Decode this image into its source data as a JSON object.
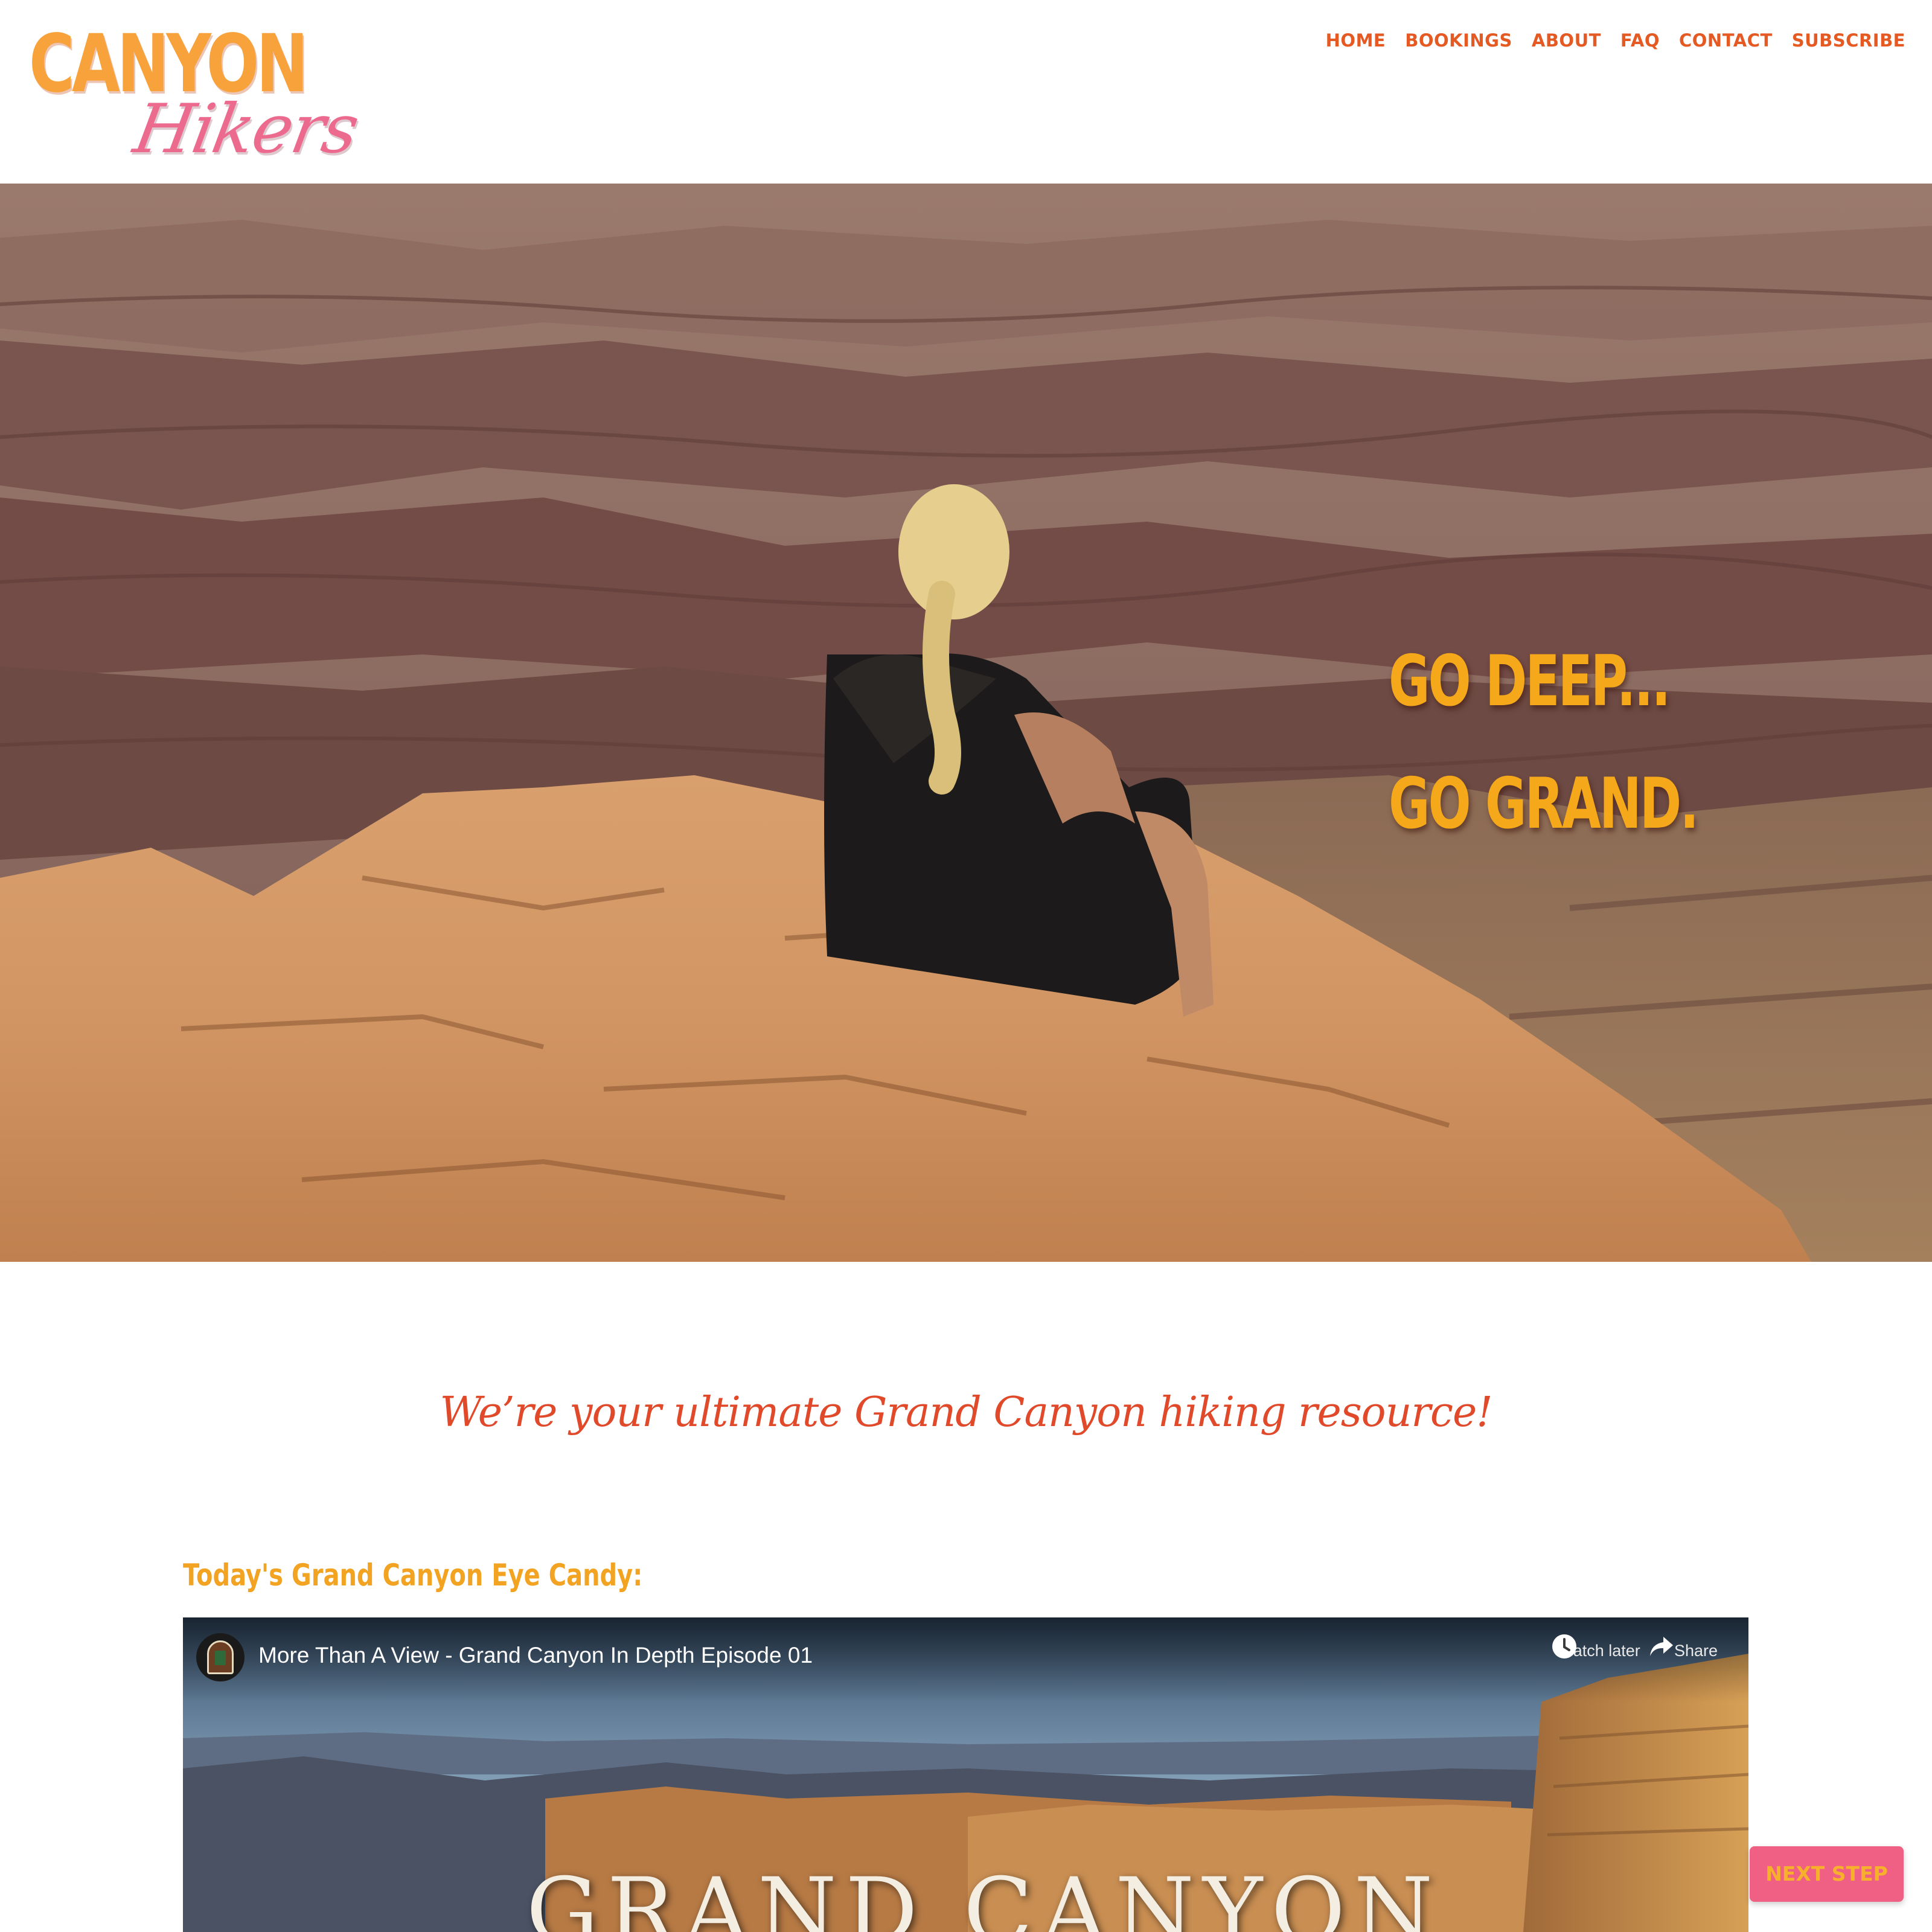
{
  "brand": {
    "logo_line1": "CANYON",
    "logo_line2": "Hikers"
  },
  "nav": {
    "items": [
      "HOME",
      "BOOKINGS",
      "ABOUT",
      "FAQ",
      "CONTACT",
      "SUBSCRIBE"
    ]
  },
  "hero": {
    "tagline_line1": "GO DEEP...",
    "tagline_line2": "GO GRAND."
  },
  "intro": {
    "text": "We’re your ultimate Grand Canyon hiking resource!"
  },
  "eye_candy": {
    "heading": "Today's Grand Canyon Eye Candy:"
  },
  "video": {
    "title": "More Than A View - Grand Canyon In Depth Episode 01",
    "watch_later_label": "Watch later",
    "share_label": "Share",
    "overlay_title": "GRAND CANYON"
  },
  "cta": {
    "next_step_label": "NEXT STEP"
  },
  "colors": {
    "nav_text": "#e55a23",
    "logo_orange": "#f7a23b",
    "logo_pink": "#ec6a8e",
    "tagline": "#f5a91a",
    "intro_text": "#e0492a",
    "eye_candy_heading": "#f2a322",
    "next_step_bg": "#f05f84",
    "next_step_text": "#f7b02c"
  },
  "icons": {
    "watch_later": "clock-icon",
    "share": "share-arrow-icon",
    "channel": "nps-arrowhead-icon"
  }
}
